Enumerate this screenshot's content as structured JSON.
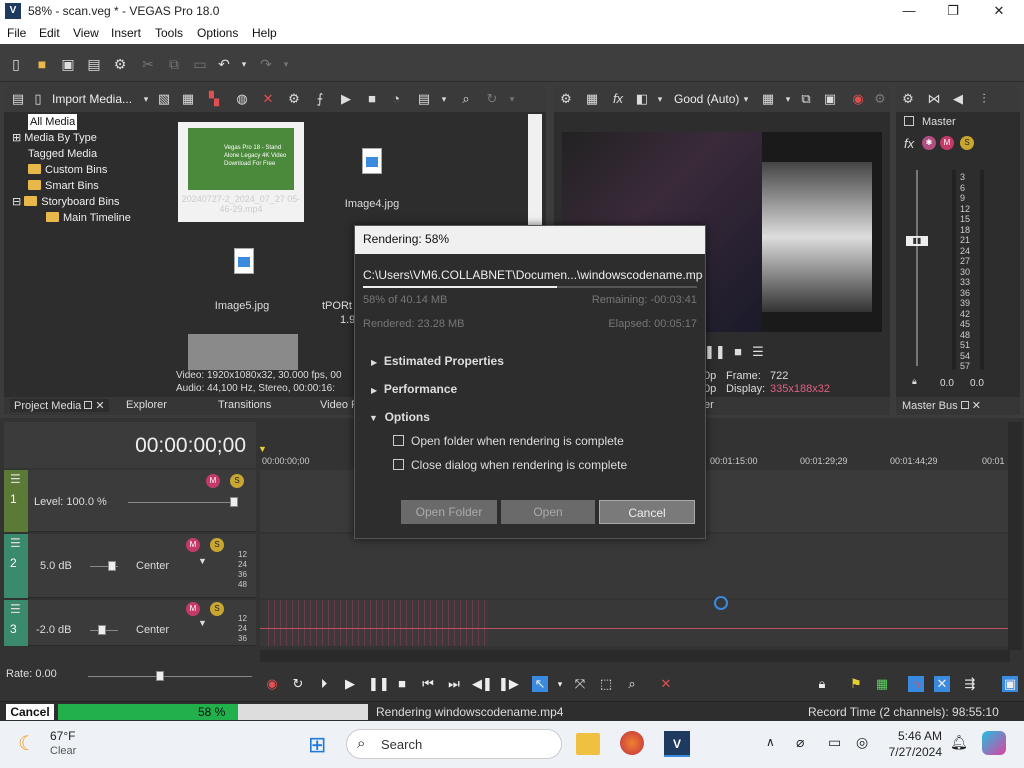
{
  "window": {
    "title": "58% - scan.veg * - VEGAS Pro 18.0",
    "logo": "V"
  },
  "menu": [
    "File",
    "Edit",
    "View",
    "Insert",
    "Tools",
    "Options",
    "Help"
  ],
  "toolbar": {
    "icons": [
      "new-file-icon",
      "open-folder-icon",
      "save-icon",
      "save-as-icon",
      "gear-icon",
      "cut-icon",
      "copy-icon",
      "paste-icon",
      "undo-icon",
      "redo-icon"
    ]
  },
  "project_media": {
    "import_label": "Import Media...",
    "tree": [
      "All Media",
      "Media By Type",
      "Tagged Media",
      "Custom Bins",
      "Smart Bins",
      "Storyboard Bins",
      "Main Timeline"
    ],
    "thumbnails": [
      {
        "name": "20240727-2_2024_07_27 05-46-29.mp4",
        "caption": "Vegas Pro 18 - Stand Alone Legacy 4K Video Download For Free"
      },
      {
        "name": "Image4.jpg"
      },
      {
        "name": "Image5.jpg"
      },
      {
        "name": "tPORt",
        "extra": "1.9"
      }
    ],
    "info_line1": "Video: 1920x1080x32, 30.000 fps, 00",
    "info_line2": "Audio: 44,100 Hz, Stereo, 00:00:16:",
    "tabs": [
      "Project Media",
      "Explorer",
      "Transitions",
      "Video F"
    ]
  },
  "preview": {
    "quality": "Good (Auto)",
    "frame_label": "Frame:",
    "frame_value": "722",
    "display_label": "Display:",
    "display_value": "335x188x32",
    "left_p1": "0p",
    "left_p2": "0p",
    "tab_suffix": "er"
  },
  "master": {
    "label": "Master",
    "scale": [
      "3",
      "6",
      "9",
      "12",
      "15",
      "18",
      "21",
      "24",
      "27",
      "30",
      "33",
      "36",
      "39",
      "42",
      "45",
      "48",
      "51",
      "54",
      "57"
    ],
    "bottom": [
      "0.0",
      "0.0"
    ],
    "tab": "Master Bus"
  },
  "timeline": {
    "timecode": "00:00:00;00",
    "ruler": [
      "00:00:00;00",
      "00:01:15:00",
      "00:01:29;29",
      "00:01:44;29",
      "00:01"
    ],
    "video_level": "Level: 100.0 %",
    "track2_db": "5.0 dB",
    "track2_pan": "Center",
    "track3_db": "-2.0 dB",
    "track3_pan": "Center",
    "meter_ticks": [
      "12",
      "24",
      "36",
      "48"
    ],
    "rate": "Rate: 0.00",
    "track_nums": [
      "1",
      "2",
      "3"
    ]
  },
  "dialog": {
    "title": "Rendering: 58%",
    "path": "C:\\Users\\VM6.COLLABNET\\Documen...\\windowscodename.mp4",
    "progress": 0.58,
    "done": "58% of 40.14 MB",
    "remaining": "Remaining: -00:03:41",
    "rendered": "Rendered: 23.28 MB",
    "elapsed": "Elapsed: 00:05:17",
    "sections": [
      "Estimated Properties",
      "Performance",
      "Options"
    ],
    "opt1": "Open folder when rendering is complete",
    "opt2": "Close dialog when rendering is complete",
    "btn_open_folder": "Open Folder",
    "btn_open": "Open",
    "btn_cancel": "Cancel"
  },
  "status": {
    "cancel": "Cancel",
    "percent": "58 %",
    "progress": 0.58,
    "rendering": "Rendering windowscodename.mp4",
    "record": "Record Time (2 channels): 98:55:10"
  },
  "taskbar": {
    "temp": "67°F",
    "weather": "Clear",
    "search": "Search",
    "time": "5:46 AM",
    "date": "7/27/2024"
  },
  "colors": {
    "accent": "#3a8be0",
    "progress_green": "#21b04b",
    "vegas_blue": "#1e3a5f"
  }
}
